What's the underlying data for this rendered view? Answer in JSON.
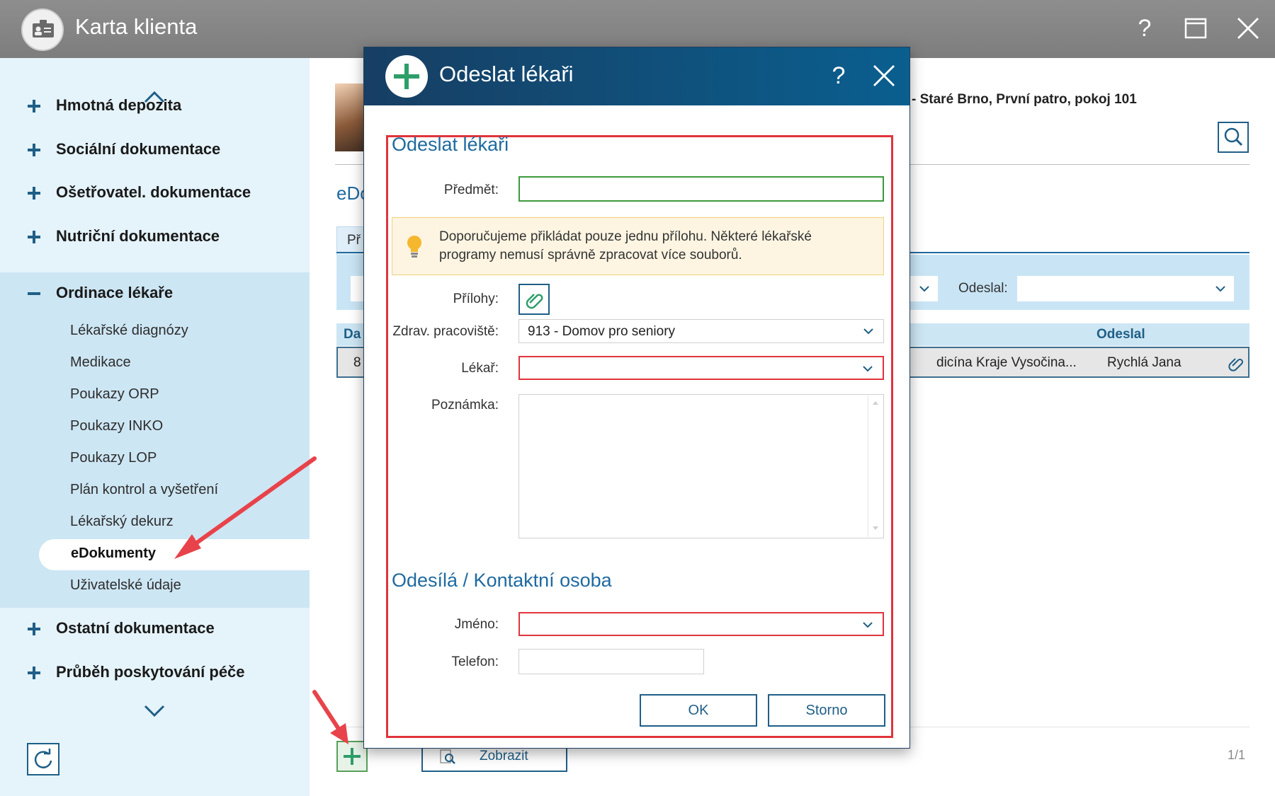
{
  "window": {
    "title": "Karta klienta",
    "help_glyph": "?"
  },
  "sidebar": {
    "items_top": [
      {
        "label": "Hmotná depozita"
      },
      {
        "label": "Sociální dokumentace"
      },
      {
        "label": "Ošetřovatel. dokumentace"
      },
      {
        "label": "Nutriční dokumentace"
      }
    ],
    "open_group": {
      "label": "Ordinace lékaře",
      "sub_items": [
        {
          "label": "Lékařské diagnózy"
        },
        {
          "label": "Medikace"
        },
        {
          "label": "Poukazy ORP"
        },
        {
          "label": "Poukazy INKO"
        },
        {
          "label": "Poukazy LOP"
        },
        {
          "label": "Plán kontrol a vyšetření"
        },
        {
          "label": "Lékařský dekurz"
        },
        {
          "label": "eDokumenty"
        },
        {
          "label": "Uživatelské údaje"
        }
      ],
      "active_index": 7
    },
    "items_bottom": [
      {
        "label": "Ostatní dokumentace"
      },
      {
        "label": "Průběh poskytování péče"
      }
    ]
  },
  "main": {
    "patient_location": "- Staré Brno, První patro, pokoj 101",
    "section_title": "eDo",
    "tab_stub": "Př",
    "filter": {
      "odeslal_label": "Odeslal:"
    },
    "grid": {
      "headers": {
        "col1": "Da",
        "odeslal": "Odeslal"
      },
      "row": {
        "col1": "8",
        "facility": "dicína Kraje Vysočina...",
        "sender": "Rychlá Jana"
      }
    },
    "show_button": "Zobrazit",
    "pager": "1/1"
  },
  "dialog": {
    "title": "Odeslat lékaři",
    "help_glyph": "?",
    "section1_title": "Odeslat lékaři",
    "subject_label": "Předmět:",
    "subject_value": "",
    "tip": "Doporučujeme přikládat pouze jednu přílohu. Některé lékařské programy nemusí správně zpracovat více souborů.",
    "attachments_label": "Přílohy:",
    "workplace_label": "Zdrav. pracoviště:",
    "workplace_value": "913 - Domov pro seniory",
    "doctor_label": "Lékař:",
    "doctor_value": "",
    "note_label": "Poznámka:",
    "section2_title": "Odesílá / Kontaktní osoba",
    "name_label": "Jméno:",
    "name_value": "",
    "phone_label": "Telefon:",
    "phone_value": "",
    "ok_label": "OK",
    "cancel_label": "Storno"
  },
  "colors": {
    "accent_blue": "#1f6aa0",
    "dialog_header": "#173e63",
    "highlight_red": "#e0343c",
    "add_green": "#2e9e6a",
    "sidebar_bg": "#e5f3fb"
  }
}
